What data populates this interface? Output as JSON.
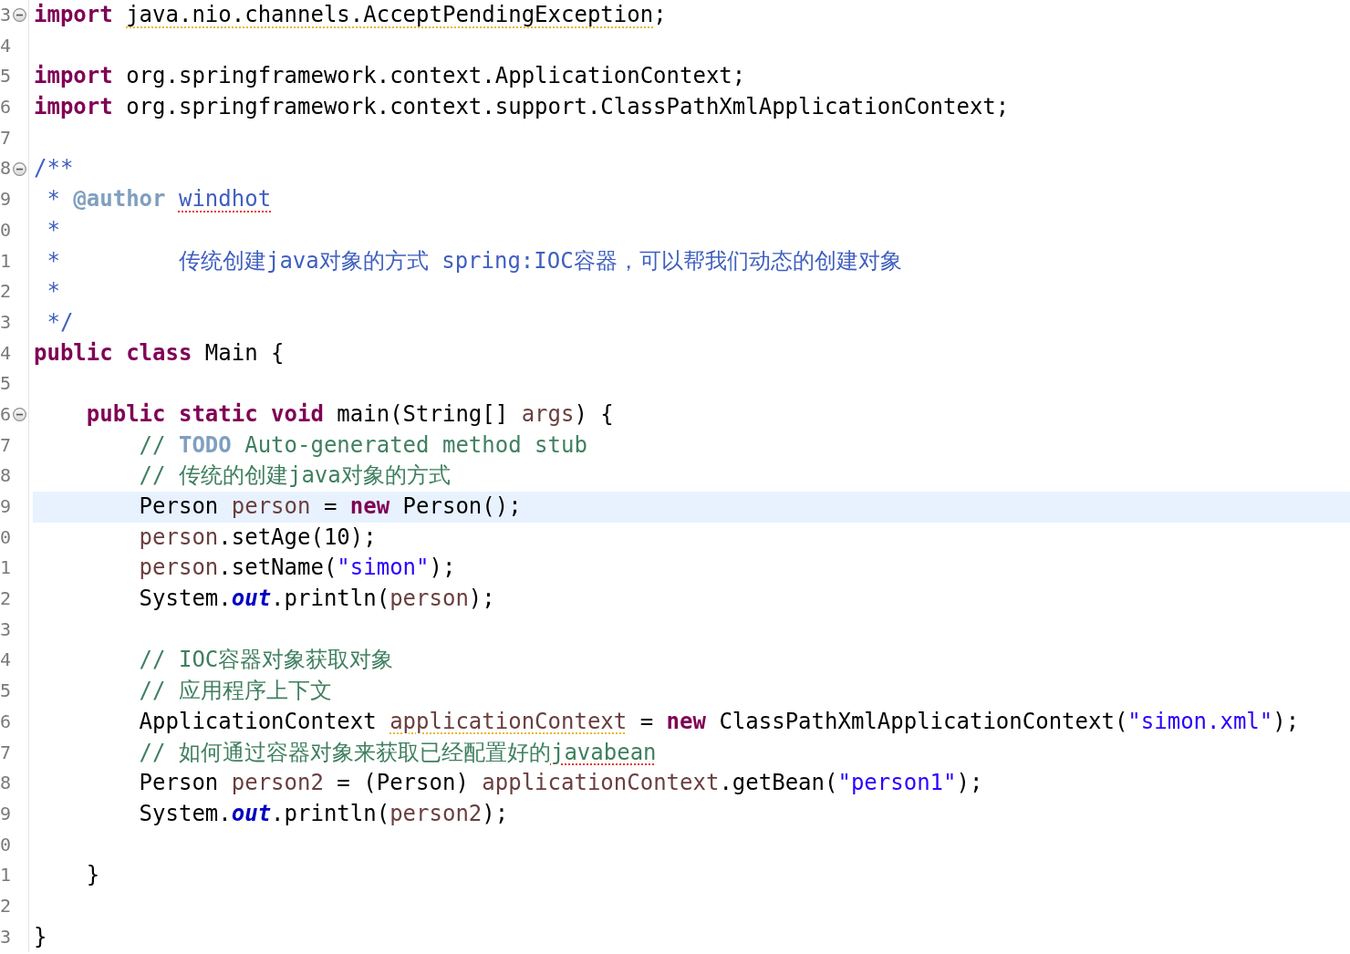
{
  "editor": {
    "lines": [
      {
        "number": "3",
        "fold_marker": true,
        "selected": false,
        "tokens": [
          {
            "kind": "keyword",
            "text": "import ",
            "warning": false,
            "misspelled": false
          },
          {
            "kind": "plain",
            "text": "java.nio.channels.AcceptPendingException",
            "warning": true,
            "misspelled": false
          },
          {
            "kind": "plain",
            "text": ";",
            "warning": false,
            "misspelled": false
          }
        ]
      },
      {
        "number": "4",
        "fold_marker": false,
        "selected": false
      },
      {
        "number": "5",
        "fold_marker": false,
        "selected": false,
        "tokens": [
          {
            "kind": "keyword",
            "text": "import",
            "warning": false,
            "misspelled": false
          },
          {
            "kind": "plain",
            "text": " org.springframework.context.ApplicationContext;",
            "warning": false,
            "misspelled": false
          }
        ]
      },
      {
        "number": "6",
        "fold_marker": false,
        "selected": false,
        "tokens": [
          {
            "kind": "keyword",
            "text": "import",
            "warning": false,
            "misspelled": false
          },
          {
            "kind": "plain",
            "text": " org.springframework.context.support.ClassPathXmlApplicationContext;",
            "warning": false,
            "misspelled": false
          }
        ]
      },
      {
        "number": "7",
        "fold_marker": false,
        "selected": false
      },
      {
        "number": "8",
        "fold_marker": true,
        "selected": false,
        "tokens": [
          {
            "kind": "javadoc",
            "text": "/**",
            "warning": false,
            "misspelled": false
          }
        ],
        "children": [
          {
            "number": "9",
            "fold_marker": false,
            "selected": false,
            "tokens": [
              {
                "kind": "javadoc",
                "text": "* ",
                "warning": false,
                "misspelled": false
              },
              {
                "kind": "javadoc_tag",
                "text": "@author ",
                "warning": false,
                "misspelled": false
              },
              {
                "kind": "javadoc",
                "text": "windhot",
                "warning": false,
                "misspelled": true
              }
            ]
          },
          {
            "number": "0",
            "fold_marker": false,
            "selected": false,
            "tokens": [
              {
                "kind": "javadoc",
                "text": "*",
                "warning": false,
                "misspelled": false
              }
            ]
          },
          {
            "number": "1",
            "fold_marker": false,
            "selected": false,
            "tokens": [
              {
                "kind": "javadoc",
                "text": "*         传统创建java对象的方式 spring:IOC容器，可以帮我们动态的创建对象",
                "warning": false,
                "misspelled": false
              }
            ]
          },
          {
            "number": "2",
            "fold_marker": false,
            "selected": false,
            "tokens": [
              {
                "kind": "javadoc",
                "text": "*",
                "warning": false,
                "misspelled": false
              }
            ]
          },
          {
            "number": "3",
            "fold_marker": false,
            "selected": false,
            "tokens": [
              {
                "kind": "javadoc",
                "text": "*/",
                "warning": false,
                "misspelled": false
              }
            ]
          }
        ]
      },
      {
        "number": "4",
        "fold_marker": false,
        "selected": false,
        "tokens": [
          {
            "kind": "keyword",
            "text": "public class",
            "warning": false,
            "misspelled": false
          },
          {
            "kind": "plain",
            "text": " Main {",
            "warning": false,
            "misspelled": false
          }
        ],
        "children": [
          {
            "number": "5",
            "fold_marker": false,
            "selected": false
          },
          {
            "number": "6",
            "fold_marker": true,
            "selected": false,
            "tokens": [
              {
                "kind": "keyword",
                "text": "public static void",
                "warning": false,
                "misspelled": false
              },
              {
                "kind": "plain",
                "text": " main(String[] ",
                "warning": false,
                "misspelled": false
              },
              {
                "kind": "local",
                "text": "args",
                "warning": false,
                "misspelled": false
              },
              {
                "kind": "plain",
                "text": ") {",
                "warning": false,
                "misspelled": false
              }
            ],
            "children": [
              {
                "number": "7",
                "fold_marker": false,
                "selected": false,
                "tokens": [
                  {
                    "kind": "comment",
                    "text": "// ",
                    "warning": false,
                    "misspelled": false
                  },
                  {
                    "kind": "task_tag",
                    "text": "TODO",
                    "warning": false,
                    "misspelled": false
                  },
                  {
                    "kind": "comment",
                    "text": " Auto-generated method stub",
                    "warning": false,
                    "misspelled": false
                  }
                ]
              },
              {
                "number": "8",
                "fold_marker": false,
                "selected": false,
                "tokens": [
                  {
                    "kind": "comment",
                    "text": "// 传统的创建java对象的方式",
                    "warning": false,
                    "misspelled": false
                  }
                ]
              },
              {
                "number": "9",
                "fold_marker": false,
                "selected": true,
                "tokens": [
                  {
                    "kind": "plain",
                    "text": "Person ",
                    "warning": false,
                    "misspelled": false
                  },
                  {
                    "kind": "local",
                    "text": "person",
                    "warning": false,
                    "misspelled": false
                  },
                  {
                    "kind": "plain",
                    "text": " = ",
                    "warning": false,
                    "misspelled": false
                  },
                  {
                    "kind": "keyword",
                    "text": "new",
                    "warning": false,
                    "misspelled": false
                  },
                  {
                    "kind": "plain",
                    "text": " Person();",
                    "warning": false,
                    "misspelled": false
                  }
                ]
              },
              {
                "number": "0",
                "fold_marker": false,
                "selected": false,
                "tokens": [
                  {
                    "kind": "local",
                    "text": "person",
                    "warning": false,
                    "misspelled": false
                  },
                  {
                    "kind": "plain",
                    "text": ".setAge(10);",
                    "warning": false,
                    "misspelled": false
                  }
                ]
              },
              {
                "number": "1",
                "fold_marker": false,
                "selected": false,
                "tokens": [
                  {
                    "kind": "local",
                    "text": "person",
                    "warning": false,
                    "misspelled": false
                  },
                  {
                    "kind": "plain",
                    "text": ".setName(",
                    "warning": false,
                    "misspelled": false
                  },
                  {
                    "kind": "string",
                    "text": "\"simon\"",
                    "warning": false,
                    "misspelled": false
                  },
                  {
                    "kind": "plain",
                    "text": ");",
                    "warning": false,
                    "misspelled": false
                  }
                ]
              },
              {
                "number": "2",
                "fold_marker": false,
                "selected": false,
                "tokens": [
                  {
                    "kind": "plain",
                    "text": "System.",
                    "warning": false,
                    "misspelled": false
                  },
                  {
                    "kind": "static_field",
                    "text": "out",
                    "warning": false,
                    "misspelled": false
                  },
                  {
                    "kind": "plain",
                    "text": ".println(",
                    "warning": false,
                    "misspelled": false
                  },
                  {
                    "kind": "local",
                    "text": "person",
                    "warning": false,
                    "misspelled": false
                  },
                  {
                    "kind": "plain",
                    "text": ");",
                    "warning": false,
                    "misspelled": false
                  }
                ]
              },
              {
                "number": "3",
                "fold_marker": false,
                "selected": false
              },
              {
                "number": "4",
                "fold_marker": false,
                "selected": false,
                "tokens": [
                  {
                    "kind": "comment",
                    "text": "// IOC容器对象获取对象",
                    "warning": false,
                    "misspelled": false
                  }
                ]
              },
              {
                "number": "5",
                "fold_marker": false,
                "selected": false,
                "tokens": [
                  {
                    "kind": "comment",
                    "text": "// 应用程序上下文",
                    "warning": false,
                    "misspelled": false
                  }
                ]
              },
              {
                "number": "6",
                "fold_marker": false,
                "selected": false,
                "tokens": [
                  {
                    "kind": "plain",
                    "text": "ApplicationContext ",
                    "warning": false,
                    "misspelled": false
                  },
                  {
                    "kind": "local",
                    "text": "applicationContext",
                    "warning": true,
                    "misspelled": false
                  },
                  {
                    "kind": "plain",
                    "text": " = ",
                    "warning": false,
                    "misspelled": false
                  },
                  {
                    "kind": "keyword",
                    "text": "new",
                    "warning": false,
                    "misspelled": false
                  },
                  {
                    "kind": "plain",
                    "text": " ClassPathXmlApplicationContext(",
                    "warning": false,
                    "misspelled": false
                  },
                  {
                    "kind": "string",
                    "text": "\"simon.xml\"",
                    "warning": false,
                    "misspelled": false
                  },
                  {
                    "kind": "plain",
                    "text": ");",
                    "warning": false,
                    "misspelled": false
                  }
                ]
              },
              {
                "number": "7",
                "fold_marker": false,
                "selected": false,
                "tokens": [
                  {
                    "kind": "comment",
                    "text": "// 如何通过容器对象来获取已经配置好的",
                    "warning": false,
                    "misspelled": false
                  },
                  {
                    "kind": "comment",
                    "text": "javabean",
                    "warning": false,
                    "misspelled": true
                  }
                ]
              },
              {
                "number": "8",
                "fold_marker": false,
                "selected": false,
                "tokens": [
                  {
                    "kind": "plain",
                    "text": "Person ",
                    "warning": false,
                    "misspelled": false
                  },
                  {
                    "kind": "local",
                    "text": "person2",
                    "warning": false,
                    "misspelled": false
                  },
                  {
                    "kind": "plain",
                    "text": " = (Person) ",
                    "warning": false,
                    "misspelled": false
                  },
                  {
                    "kind": "local",
                    "text": "applicationContext",
                    "warning": false,
                    "misspelled": false
                  },
                  {
                    "kind": "plain",
                    "text": ".getBean(",
                    "warning": false,
                    "misspelled": false
                  },
                  {
                    "kind": "string",
                    "text": "\"person1\"",
                    "warning": false,
                    "misspelled": false
                  },
                  {
                    "kind": "plain",
                    "text": ");",
                    "warning": false,
                    "misspelled": false
                  }
                ]
              },
              {
                "number": "9",
                "fold_marker": false,
                "selected": false,
                "tokens": [
                  {
                    "kind": "plain",
                    "text": "System.",
                    "warning": false,
                    "misspelled": false
                  },
                  {
                    "kind": "static_field",
                    "text": "out",
                    "warning": false,
                    "misspelled": false
                  },
                  {
                    "kind": "plain",
                    "text": ".println(",
                    "warning": false,
                    "misspelled": false
                  },
                  {
                    "kind": "local",
                    "text": "person2",
                    "warning": false,
                    "misspelled": false
                  },
                  {
                    "kind": "plain",
                    "text": ");",
                    "warning": false,
                    "misspelled": false
                  }
                ]
              },
              {
                "number": "0",
                "fold_marker": false,
                "selected": false
              }
            ]
          },
          {
            "number": "1",
            "fold_marker": false,
            "selected": false,
            "tokens": [
              {
                "kind": "plain",
                "text": "}",
                "warning": false,
                "misspelled": false
              }
            ]
          },
          {
            "number": "2",
            "fold_marker": false,
            "selected": false
          }
        ]
      },
      {
        "number": "3",
        "fold_marker": false,
        "selected": false,
        "tokens": [
          {
            "kind": "plain",
            "text": "}",
            "warning": false,
            "misspelled": false
          }
        ]
      }
    ]
  }
}
